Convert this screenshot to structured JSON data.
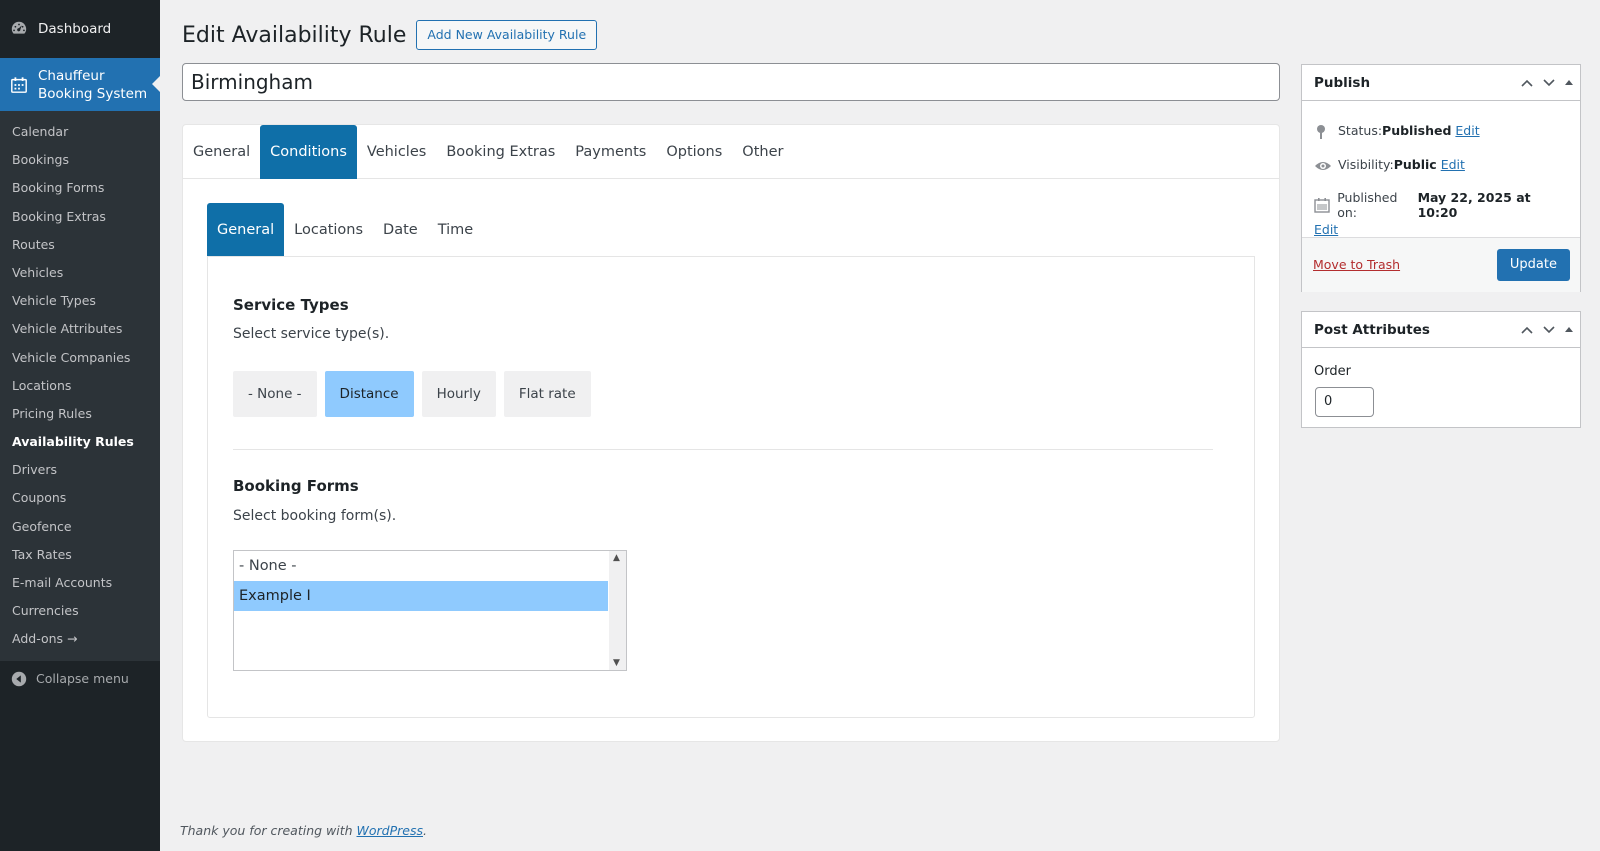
{
  "sidebar": {
    "dashboard_label": "Dashboard",
    "plugin_label_line1": "Chauffeur",
    "plugin_label_line2": "Booking System",
    "items": [
      {
        "label": "Calendar"
      },
      {
        "label": "Bookings"
      },
      {
        "label": "Booking Forms"
      },
      {
        "label": "Booking Extras"
      },
      {
        "label": "Routes"
      },
      {
        "label": "Vehicles"
      },
      {
        "label": "Vehicle Types"
      },
      {
        "label": "Vehicle Attributes"
      },
      {
        "label": "Vehicle Companies"
      },
      {
        "label": "Locations"
      },
      {
        "label": "Pricing Rules"
      },
      {
        "label": "Availability Rules"
      },
      {
        "label": "Drivers"
      },
      {
        "label": "Coupons"
      },
      {
        "label": "Geofence"
      },
      {
        "label": "Tax Rates"
      },
      {
        "label": "E-mail Accounts"
      },
      {
        "label": "Currencies"
      },
      {
        "label": "Add-ons →"
      }
    ],
    "active_item": "Availability Rules",
    "collapse_label": "Collapse menu"
  },
  "header": {
    "title": "Edit Availability Rule",
    "add_new_label": "Add New Availability Rule"
  },
  "post_title": "Birmingham",
  "tabs": [
    "General",
    "Conditions",
    "Vehicles",
    "Booking Extras",
    "Payments",
    "Options",
    "Other"
  ],
  "active_tab": "Conditions",
  "subtabs": [
    "General",
    "Locations",
    "Date",
    "Time"
  ],
  "active_subtab": "General",
  "service_types": {
    "title": "Service Types",
    "description": "Select service type(s).",
    "options": [
      "- None -",
      "Distance",
      "Hourly",
      "Flat rate"
    ],
    "selected": "Distance"
  },
  "booking_forms": {
    "title": "Booking Forms",
    "description": "Select booking form(s).",
    "options": [
      "- None -",
      "Example I"
    ],
    "selected": "Example I"
  },
  "footer": {
    "text_prefix": "Thank you for creating with ",
    "link": "WordPress",
    "text_suffix": "."
  },
  "publish": {
    "title": "Publish",
    "status_label": "Status: ",
    "status_value": "Published",
    "visibility_label": "Visibility: ",
    "visibility_value": "Public",
    "published_label": "Published on: ",
    "published_value": "May 22, 2025 at 10:20",
    "edit_label": "Edit",
    "trash_label": "Move to Trash",
    "update_label": "Update"
  },
  "attributes": {
    "title": "Post Attributes",
    "order_label": "Order",
    "order_value": "0"
  },
  "colors": {
    "accent": "#2271b1",
    "tab_active": "#0f6fa8",
    "selected_option": "#8fcafe",
    "sidebar_bg": "#1d2327"
  }
}
